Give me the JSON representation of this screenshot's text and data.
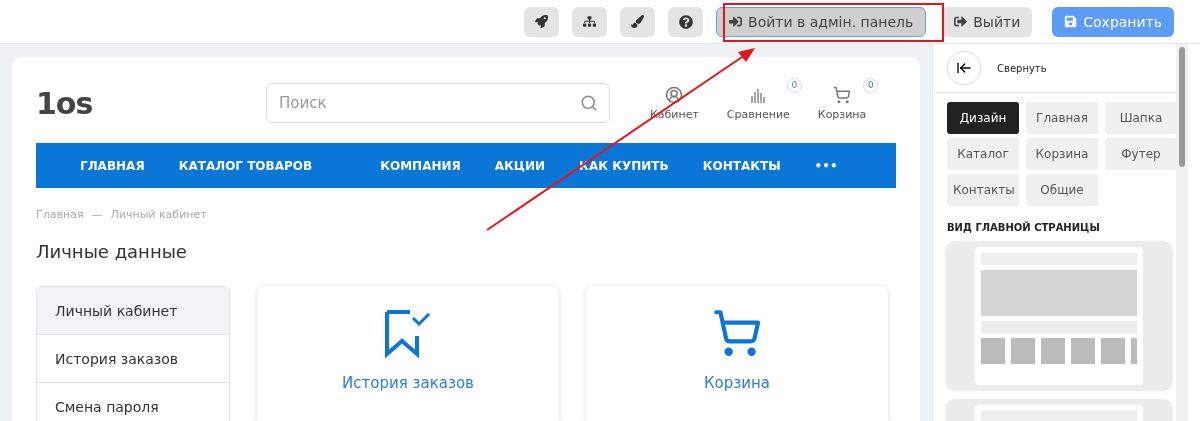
{
  "toolbar": {
    "icon_buttons": [
      {
        "kind": "rocket"
      },
      {
        "kind": "sitemap"
      },
      {
        "kind": "brush"
      },
      {
        "kind": "help"
      }
    ],
    "admin_button": {
      "label": "Войти в адмін. панель"
    },
    "logout_button": {
      "label": "Выйти"
    },
    "save_button": {
      "label": "Сохранить"
    }
  },
  "site": {
    "logo": "1os",
    "search": {
      "placeholder": "Поиск"
    },
    "header_links": [
      {
        "kind": "user",
        "label": "Кабинет"
      },
      {
        "kind": "compare",
        "label": "Сравнение",
        "count": "0"
      },
      {
        "kind": "cart",
        "label": "Корзина",
        "count": "0"
      }
    ],
    "nav": [
      "ГЛАВНАЯ",
      "КАТАЛОГ ТОВАРОВ",
      "КОМПАНИЯ",
      "АКЦИИ",
      "КАК КУПИТЬ",
      "КОНТАКТЫ",
      "•••"
    ],
    "breadcrumbs": [
      "Главная",
      "—",
      "Личный кабинет"
    ],
    "title": "Личные данные",
    "menu": [
      {
        "label": "Личный кабинет",
        "selected": true
      },
      {
        "label": "История заказов",
        "selected": false
      },
      {
        "label": "Смена пароля",
        "selected": false
      }
    ],
    "cards": [
      {
        "kind": "history",
        "label": "История заказов"
      },
      {
        "kind": "cart",
        "label": "Корзина"
      }
    ]
  },
  "panel": {
    "collapse_label": "Свернуть",
    "tabs": [
      {
        "label": "Дизайн",
        "selected": true
      },
      {
        "label": "Главная",
        "selected": false
      },
      {
        "label": "Шапка",
        "selected": false
      },
      {
        "label": "Каталог",
        "selected": false
      },
      {
        "label": "Корзина",
        "selected": false
      },
      {
        "label": "Футер",
        "selected": false
      },
      {
        "label": "Контакты",
        "selected": false
      },
      {
        "label": "Общие",
        "selected": false
      }
    ],
    "section_title": "ВИД ГЛАВНОЙ СТРАНИЦЫ",
    "previews": [
      {
        "selected": false
      },
      {
        "selected": false
      }
    ]
  }
}
